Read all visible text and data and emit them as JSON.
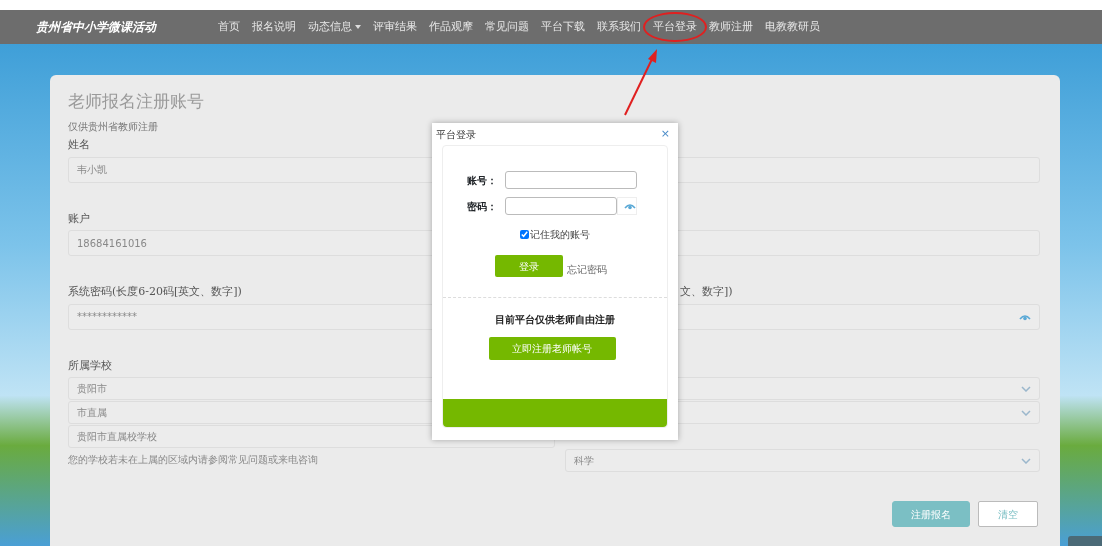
{
  "nav": {
    "brand": "贵州省中小学微课活动",
    "items": [
      {
        "label": "首页",
        "kind": "link",
        "annotated": false
      },
      {
        "label": "报名说明",
        "kind": "link",
        "annotated": false
      },
      {
        "label": "动态信息",
        "kind": "dropdown",
        "annotated": false
      },
      {
        "label": "评审结果",
        "kind": "link",
        "annotated": false
      },
      {
        "label": "作品观摩",
        "kind": "link",
        "annotated": false
      },
      {
        "label": "常见问题",
        "kind": "link",
        "annotated": false
      },
      {
        "label": "平台下载",
        "kind": "link",
        "annotated": false
      },
      {
        "label": "联系我们",
        "kind": "link",
        "annotated": false
      },
      {
        "label": "平台登录",
        "kind": "link",
        "annotated": true
      },
      {
        "label": "教师注册",
        "kind": "link",
        "annotated": false
      },
      {
        "label": "电教教研员",
        "kind": "link",
        "annotated": false
      }
    ]
  },
  "form": {
    "title": "老师报名注册账号",
    "subtitle": "仅供贵州省教师注册",
    "rows": [
      {
        "left": {
          "kind": "label",
          "text": "姓名"
        }
      },
      {
        "left": {
          "kind": "input",
          "value": "韦小凯"
        },
        "right": {
          "kind": "input"
        }
      },
      {
        "left": {
          "kind": "label",
          "text": "账户"
        }
      },
      {
        "left": {
          "kind": "input",
          "value": "18684161016"
        },
        "right": {
          "kind": "input"
        }
      },
      {
        "left": {
          "kind": "label",
          "text": "系统密码(长度6-20码[英文、数字])"
        },
        "right": {
          "kind": "label",
          "text": "文、数字])"
        }
      },
      {
        "left": {
          "kind": "password",
          "value": "************"
        },
        "right": {
          "kind": "password"
        }
      },
      {
        "left": {
          "kind": "label",
          "text": "所属学校"
        }
      },
      {
        "left": {
          "kind": "select",
          "value": "贵阳市"
        },
        "right": {
          "kind": "select"
        }
      },
      {
        "left": {
          "kind": "select",
          "value": "市直属"
        },
        "right": {
          "kind": "select"
        }
      },
      {
        "left": {
          "kind": "select",
          "value": "贵阳市直属校学校"
        }
      },
      {
        "left": {
          "kind": "hint",
          "text": "您的学校若未在上属的区域内请参阅常见问题或来电咨询"
        },
        "right": {
          "kind": "select",
          "value": "科学"
        }
      }
    ],
    "buttons": [
      {
        "label": "注册报名",
        "kind": "primary"
      },
      {
        "label": "清空",
        "kind": "outline"
      }
    ]
  },
  "modal": {
    "title": "平台登录",
    "close": "×",
    "fields": [
      {
        "label": "账号：",
        "kind": "text"
      },
      {
        "label": "密码：",
        "kind": "password"
      }
    ],
    "remember": {
      "label": "记住我的账号",
      "checked": true
    },
    "login_button": "登录",
    "forgot_link": "忘记密码",
    "notice": "目前平台仅供老师自由注册",
    "register_button": "立即注册老师帐号"
  }
}
